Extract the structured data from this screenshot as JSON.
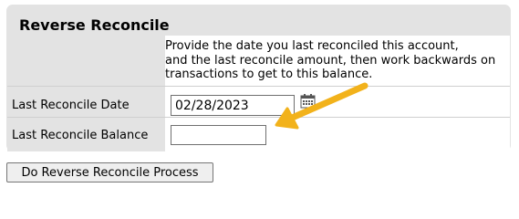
{
  "form": {
    "title": "Reverse Reconcile",
    "description": [
      "Provide the date you last reconciled this account,",
      "and the last reconcile amount, then work backwards on",
      "transactions to get to this balance."
    ],
    "fields": {
      "last_reconcile_date": {
        "label": "Last Reconcile Date",
        "value": "02/28/2023"
      },
      "last_reconcile_balance": {
        "label": "Last Reconcile Balance",
        "value": ""
      }
    },
    "submit_label": "Do Reverse Reconcile Process"
  },
  "icons": {
    "date_picker": "calendar-icon",
    "pointer": "arrow-annotation-icon"
  },
  "colors": {
    "panel_bg": "#e3e3e3",
    "arrow": "#f2b21b"
  }
}
